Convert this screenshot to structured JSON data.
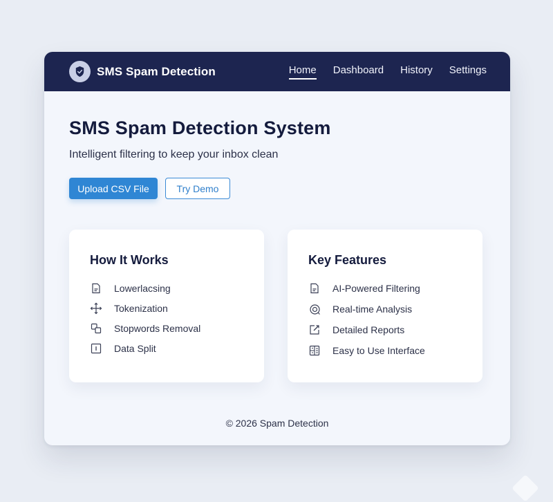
{
  "header": {
    "brand_title": "SMS Spam Detection",
    "logo_icon": "shield-check-icon",
    "nav": [
      {
        "label": "Home",
        "active": true
      },
      {
        "label": "Dashboard",
        "active": false
      },
      {
        "label": "History",
        "active": false
      },
      {
        "label": "Settings",
        "active": false
      }
    ]
  },
  "hero": {
    "title": "SMS Spam Detection System",
    "subtitle": "Intelligent filtering to keep your inbox clean",
    "primary_button": "Upload CSV File",
    "secondary_button": "Try Demo"
  },
  "how_it_works": {
    "title": "How It Works",
    "items": [
      {
        "label": "Lowerlacsing",
        "icon": "document-icon"
      },
      {
        "label": "Tokenization",
        "icon": "move-arrows-icon"
      },
      {
        "label": "Stopwords Removal",
        "icon": "layers-icon"
      },
      {
        "label": "Data Split",
        "icon": "info-box-icon"
      }
    ]
  },
  "key_features": {
    "title": "Key Features",
    "items": [
      {
        "label": "AI-Powered Filtering",
        "icon": "document-icon"
      },
      {
        "label": "Real-time Analysis",
        "icon": "radar-icon"
      },
      {
        "label": "Detailed Reports",
        "icon": "edit-icon"
      },
      {
        "label": "Easy to Use Interface",
        "icon": "grid-interface-icon"
      }
    ]
  },
  "footer": {
    "text": "© 2026 Spam Detection"
  },
  "colors": {
    "navbar": "#1d2550",
    "primary": "#2f86d4",
    "background": "#f3f6fc"
  }
}
